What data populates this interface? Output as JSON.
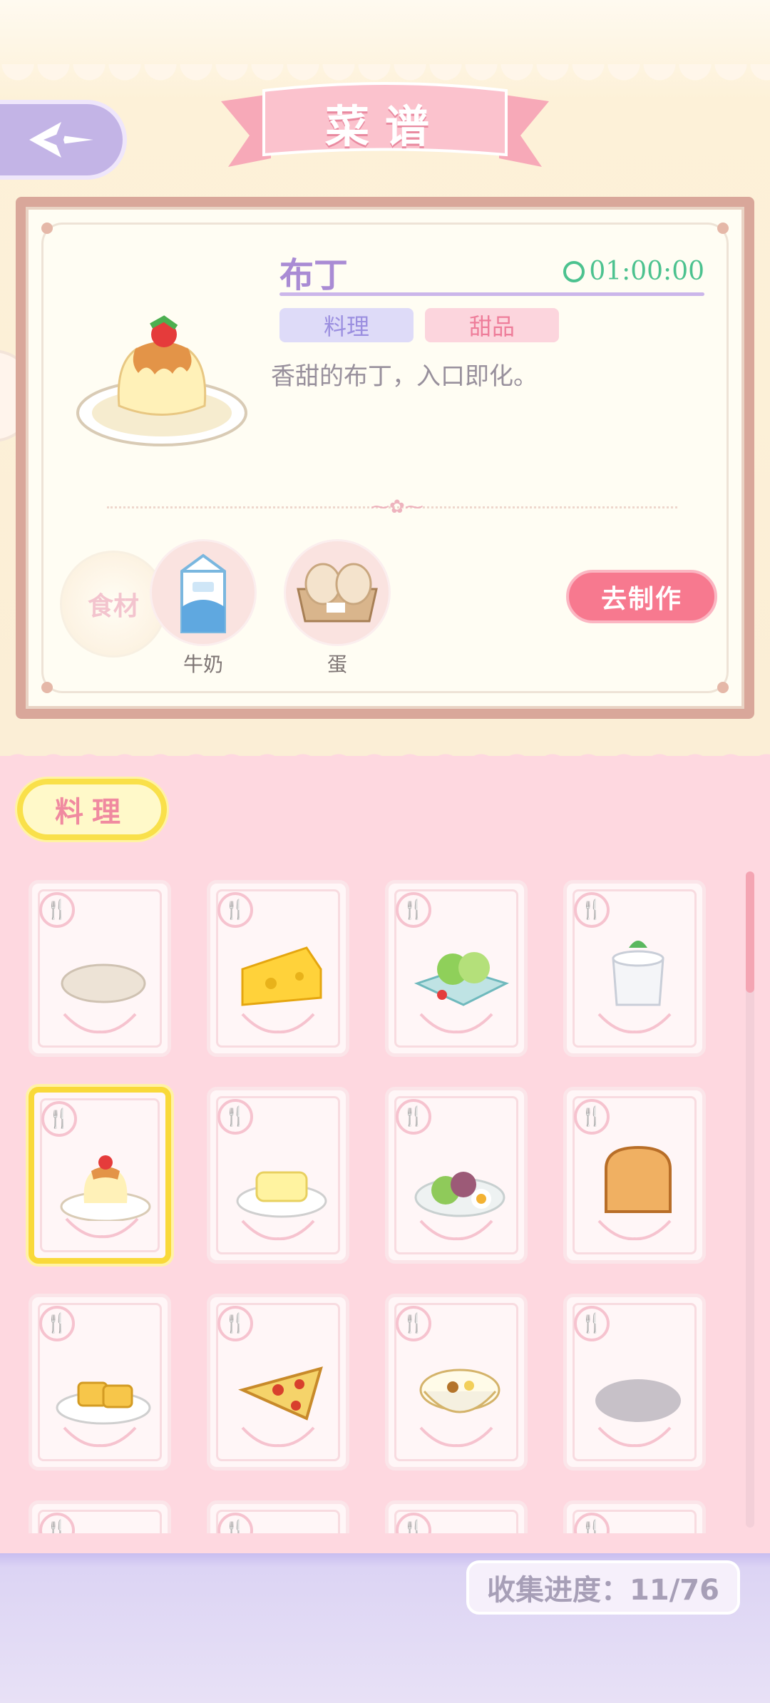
{
  "header": {
    "title": "菜谱",
    "back_icon": "back-arrow-icon"
  },
  "recipe": {
    "name": "布丁",
    "time": "01:00:00",
    "tags": [
      "料理",
      "甜品"
    ],
    "description": "香甜的布丁，入口即化。",
    "ingredients_label": "食材",
    "ingredients": [
      {
        "name": "牛奶",
        "icon": "milk-carton-icon"
      },
      {
        "name": "蛋",
        "icon": "eggs-icon"
      }
    ],
    "make_label": "去制作"
  },
  "category": {
    "label": "料理"
  },
  "grid": {
    "items": [
      {
        "name": "flatbread",
        "unlocked": true
      },
      {
        "name": "cheese",
        "unlocked": true
      },
      {
        "name": "salad",
        "unlocked": true
      },
      {
        "name": "yogurt",
        "unlocked": true
      },
      {
        "name": "pudding",
        "unlocked": true,
        "selected": true
      },
      {
        "name": "cheesecake",
        "unlocked": true
      },
      {
        "name": "egg-salad",
        "unlocked": true
      },
      {
        "name": "bread",
        "unlocked": true
      },
      {
        "name": "tamagoyaki",
        "unlocked": true
      },
      {
        "name": "pizza",
        "unlocked": true
      },
      {
        "name": "soup",
        "unlocked": true
      },
      {
        "name": "locked",
        "unlocked": false
      }
    ]
  },
  "collection": {
    "label": "收集进度：11/76",
    "collected": 11,
    "total": 76
  },
  "colors": {
    "accent_pink": "#f7798f",
    "accent_purple": "#a98bd4",
    "highlight_yellow": "#f9e04a",
    "timer_green": "#4cc28f"
  }
}
